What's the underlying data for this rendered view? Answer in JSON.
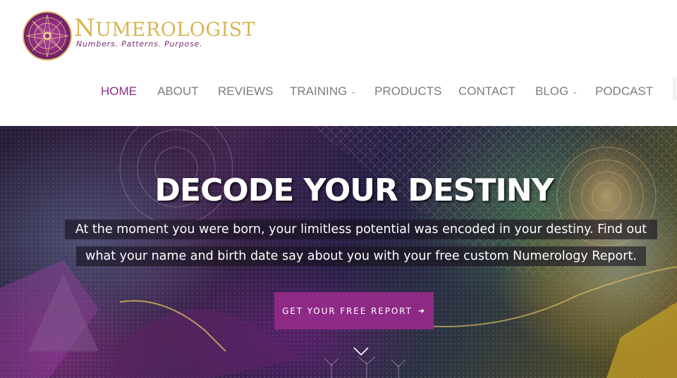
{
  "logo": {
    "name_first": "N",
    "name_rest": "UMEROLOGIST",
    "tagline": "Numbers. Patterns. Purpose."
  },
  "nav": {
    "items": [
      {
        "label": "HOME",
        "active": true,
        "has_dropdown": false
      },
      {
        "label": "ABOUT",
        "active": false,
        "has_dropdown": false
      },
      {
        "label": "REVIEWS",
        "active": false,
        "has_dropdown": false
      },
      {
        "label": "TRAINING",
        "active": false,
        "has_dropdown": true
      },
      {
        "label": "PRODUCTS",
        "active": false,
        "has_dropdown": false
      },
      {
        "label": "CONTACT",
        "active": false,
        "has_dropdown": false
      },
      {
        "label": "BLOG",
        "active": false,
        "has_dropdown": true
      },
      {
        "label": "PODCAST",
        "active": false,
        "has_dropdown": false
      }
    ],
    "dropdown_icon": "chevron-down-icon"
  },
  "hero": {
    "title": "DECODE YOUR DESTINY",
    "subtitle_line1": "At the moment you were born, your limitless potential was encoded in your destiny. Find out",
    "subtitle_line2": "what your name and birth date say about you with your free custom Numerology Report.",
    "cta_label": "GET YOUR FREE REPORT",
    "cta_icon": "arrow-right-icon",
    "scroll_icon": "chevron-down-icon"
  },
  "colors": {
    "accent": "#8e2a86",
    "nav_active": "#8b2d82",
    "nav_text": "#7c7c7c",
    "logo_gold": "#d9b552",
    "logo_purple": "#7a2a73"
  }
}
